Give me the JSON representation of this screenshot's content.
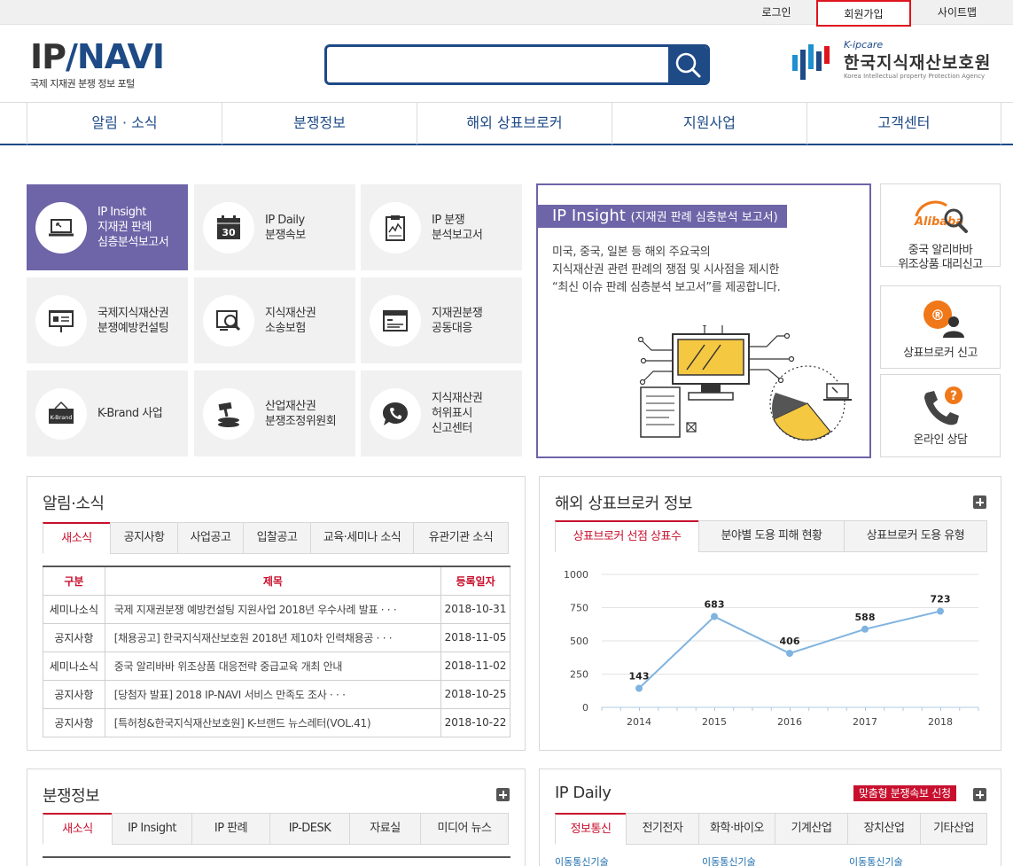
{
  "topbar": {
    "login": "로그인",
    "join": "회원가입",
    "sitemap": "사이트맵"
  },
  "logo": {
    "mark_ip": "IP",
    "mark_navi": "NAVI",
    "sub": "국제 지재권 분쟁 정보 포털"
  },
  "search": {
    "value": "",
    "placeholder": ""
  },
  "kipo": {
    "small": "K-ipcare",
    "name": "한국지식재산보호원",
    "eng": "Korea Intellectual property Protection Agency"
  },
  "gnb": [
    "알림 · 소식",
    "분쟁정보",
    "해외 상표브로커",
    "지원사업",
    "고객센터"
  ],
  "tiles": [
    {
      "lines": [
        "IP Insight",
        "지재권 판례",
        "심층분석보고서"
      ],
      "icon": "laptop-icon"
    },
    {
      "lines": [
        "IP Daily",
        "분쟁속보"
      ],
      "icon": "calendar-icon",
      "day": "30"
    },
    {
      "lines": [
        "IP 분쟁",
        "분석보고서"
      ],
      "icon": "clipboard-chart-icon"
    },
    {
      "lines": [
        "국제지식재산권",
        "분쟁예방컨설팅"
      ],
      "icon": "presentation-board-icon"
    },
    {
      "lines": [
        "지식재산권",
        "소송보험"
      ],
      "icon": "document-magnifier-icon"
    },
    {
      "lines": [
        "지재권분쟁",
        "공동대응"
      ],
      "icon": "browser-window-icon"
    },
    {
      "lines": [
        "K-Brand 사업"
      ],
      "icon": "k-brand-sign-icon",
      "sign": "K-Brand"
    },
    {
      "lines": [
        "산업재산권",
        "분쟁조정위원회"
      ],
      "icon": "gavel-icon"
    },
    {
      "lines": [
        "지식재산권",
        "허위표시",
        "신고센터"
      ],
      "icon": "phone-bubble-icon"
    }
  ],
  "insight": {
    "title": "IP Insight",
    "subtitle": "(지재권 판례 심층분석 보고서)",
    "desc": [
      "미국, 중국, 일본 등 해외 주요국의",
      "지식재산권 관련 판례의 쟁점 및 시사점을 제시한",
      "“최신 이슈 판례 심층분석 보고서”를 제공합니다."
    ]
  },
  "sideboxes": [
    {
      "lines": [
        "중국 알리바바",
        "위조상품 대리신고"
      ],
      "logo": "Alibaba",
      "icon": "alibaba-magnifier-icon"
    },
    {
      "lines": [
        "상표브로커 신고"
      ],
      "icon": "trademark-person-icon"
    },
    {
      "lines": [
        "온라인 상담"
      ],
      "icon": "phone-question-icon"
    }
  ],
  "news": {
    "title": "알림·소식",
    "tabs": [
      "새소식",
      "공지사항",
      "사업공고",
      "입찰공고",
      "교육·세미나 소식",
      "유관기관 소식"
    ],
    "headers": [
      "구분",
      "제목",
      "등록일자"
    ],
    "rows": [
      [
        "세미나소식",
        "국제 지재권분쟁 예방컨설팅 지원사업 2018년 우수사례 발표 · · ·",
        "2018-10-31"
      ],
      [
        "공지사항",
        "[채용공고] 한국지식재산보호원 2018년 제10차 인력채용공 · · ·",
        "2018-11-05"
      ],
      [
        "세미나소식",
        "중국 알리바바 위조상품 대응전략 중급교육 개최 안내",
        "2018-11-02"
      ],
      [
        "공지사항",
        "[당첨자 발표] 2018 IP-NAVI 서비스 만족도 조사 · · ·",
        "2018-10-25"
      ],
      [
        "공지사항",
        "[특허청&한국지식재산보호원] K-브랜드 뉴스레터(VOL.41)",
        "2018-10-22"
      ]
    ]
  },
  "broker": {
    "title": "해외 상표브로커 정보",
    "tabs": [
      "상표브로커 선점 상표수",
      "분야별 도용 피해 현황",
      "상표브로커 도용 유형"
    ]
  },
  "chart_data": {
    "type": "line",
    "x": [
      "2014",
      "2015",
      "2016",
      "2017",
      "2018"
    ],
    "values": [
      143,
      683,
      406,
      588,
      723
    ],
    "ylim": [
      0,
      1000
    ],
    "yticks": [
      "1000",
      "750",
      "500",
      "250",
      "0"
    ],
    "grid": true,
    "color": "#7fb3e0"
  },
  "dispute": {
    "title": "분쟁정보",
    "tabs": [
      "새소식",
      "IP Insight",
      "IP 판례",
      "IP-DESK",
      "자료실",
      "미디어 뉴스"
    ]
  },
  "daily": {
    "title": "IP Daily",
    "button": "맞춤형 분쟁속보 신청",
    "tabs": [
      "정보통신",
      "전기전자",
      "화학·바이오",
      "기계산업",
      "장치산업",
      "기타산업"
    ],
    "sub": [
      "이동통신기술",
      "이동통신기술",
      "이동통신기술"
    ]
  },
  "colors": {
    "brand": "#1e4a86",
    "accent": "#6e64a8",
    "red": "#c8102e"
  }
}
